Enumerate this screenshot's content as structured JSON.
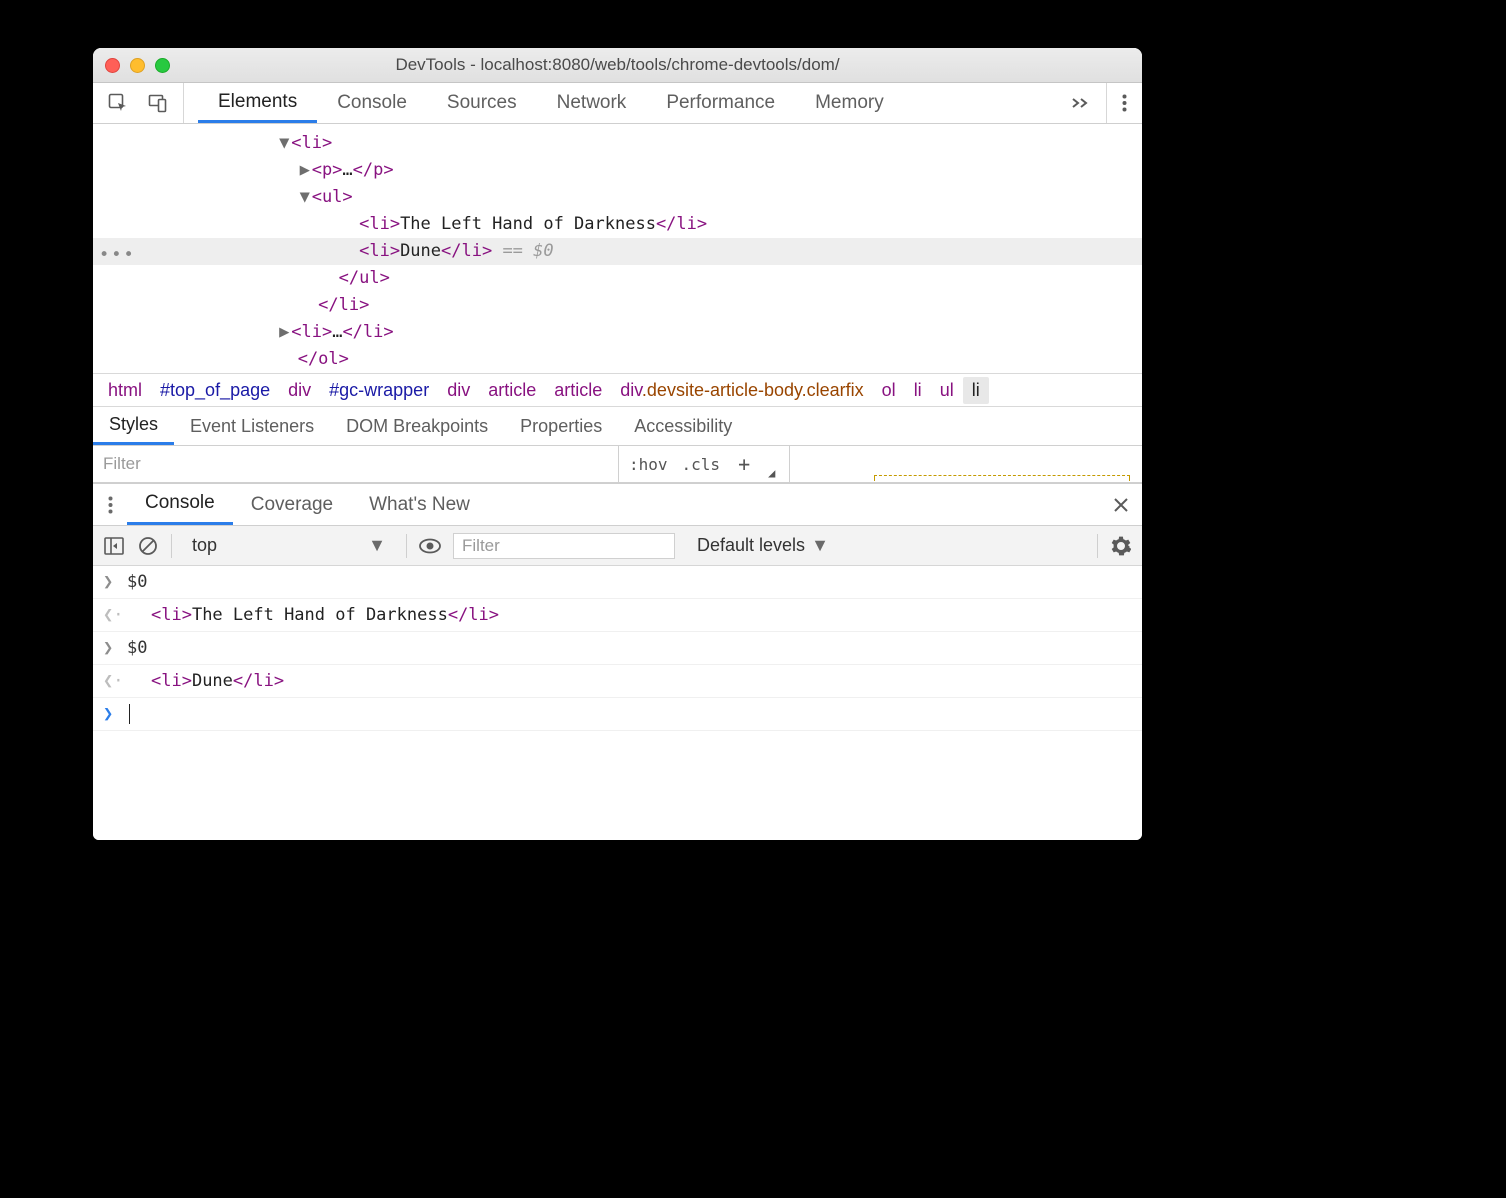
{
  "window": {
    "title": "DevTools - localhost:8080/web/tools/chrome-devtools/dom/"
  },
  "tabs": {
    "items": [
      "Elements",
      "Console",
      "Sources",
      "Network",
      "Performance",
      "Memory"
    ],
    "active": "Elements"
  },
  "tree": {
    "rows": [
      {
        "indent": 18,
        "tri": "▼",
        "open": "<li>",
        "text": "",
        "close": ""
      },
      {
        "indent": 20,
        "tri": "▶",
        "open": "<p>",
        "text": "…",
        "close": "</p>"
      },
      {
        "indent": 20,
        "tri": "▼",
        "open": "<ul>",
        "text": "",
        "close": ""
      },
      {
        "indent": 24,
        "tri": "",
        "open": "<li>",
        "text": "The Left Hand of Darkness",
        "close": "</li>"
      },
      {
        "indent": 24,
        "tri": "",
        "open": "<li>",
        "text": "Dune",
        "close": "</li>",
        "selected": true,
        "sel_suffix": " == $0"
      },
      {
        "indent": 22,
        "tri": "",
        "open": "</ul>",
        "text": "",
        "close": ""
      },
      {
        "indent": 20,
        "tri": "",
        "open": "</li>",
        "text": "",
        "close": ""
      },
      {
        "indent": 18,
        "tri": "▶",
        "open": "<li>",
        "text": "…",
        "close": "</li>"
      },
      {
        "indent": 18,
        "tri": "",
        "open": "</ol>",
        "text": "",
        "close": ""
      }
    ]
  },
  "breadcrumbs": [
    {
      "label": "html",
      "kind": "tag"
    },
    {
      "label": "#top_of_page",
      "kind": "id"
    },
    {
      "label": "div",
      "kind": "tag"
    },
    {
      "label": "#gc-wrapper",
      "kind": "id"
    },
    {
      "label": "div",
      "kind": "tag"
    },
    {
      "label": "article",
      "kind": "tag"
    },
    {
      "label": "article",
      "kind": "tag"
    },
    {
      "label": "div.devsite-article-body.clearfix",
      "kind": "mix",
      "tagPart": "div",
      "clsPart": ".devsite-article-body.clearfix"
    },
    {
      "label": "ol",
      "kind": "tag"
    },
    {
      "label": "li",
      "kind": "tag"
    },
    {
      "label": "ul",
      "kind": "tag"
    },
    {
      "label": "li",
      "kind": "last"
    }
  ],
  "subtabs": {
    "items": [
      "Styles",
      "Event Listeners",
      "DOM Breakpoints",
      "Properties",
      "Accessibility"
    ],
    "active": "Styles"
  },
  "stylesbar": {
    "filter_placeholder": "Filter",
    "hov": ":hov",
    "cls": ".cls"
  },
  "drawer": {
    "tabs": {
      "items": [
        "Console",
        "Coverage",
        "What's New"
      ],
      "active": "Console"
    },
    "context": "top",
    "filter_placeholder": "Filter",
    "levels": "Default levels"
  },
  "console": {
    "rows": [
      {
        "kind": "in",
        "text": "$0"
      },
      {
        "kind": "out",
        "tagOpen": "<li>",
        "text": "The Left Hand of Darkness",
        "tagClose": "</li>"
      },
      {
        "kind": "in",
        "text": "$0"
      },
      {
        "kind": "out",
        "tagOpen": "<li>",
        "text": "Dune",
        "tagClose": "</li>"
      }
    ]
  }
}
